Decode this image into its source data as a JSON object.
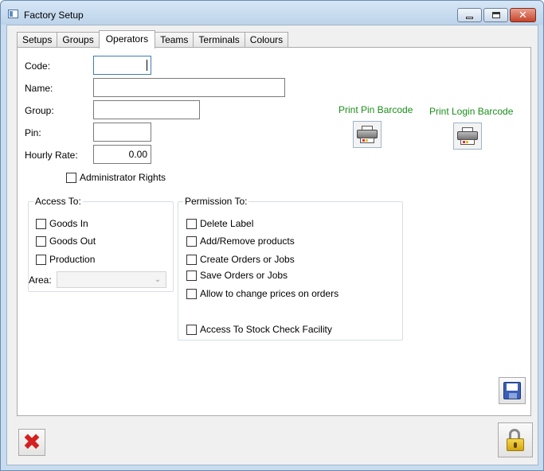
{
  "window": {
    "title": "Factory Setup"
  },
  "tabs": [
    {
      "label": "Setups",
      "active": false
    },
    {
      "label": "Groups",
      "active": false
    },
    {
      "label": "Operators",
      "active": true
    },
    {
      "label": "Teams",
      "active": false
    },
    {
      "label": "Terminals",
      "active": false
    },
    {
      "label": "Colours",
      "active": false
    }
  ],
  "form": {
    "code_label": "Code:",
    "code_value": "",
    "name_label": "Name:",
    "name_value": "",
    "group_label": "Group:",
    "group_value": "",
    "pin_label": "Pin:",
    "pin_value": "",
    "hourly_rate_label": "Hourly Rate:",
    "hourly_rate_value": "0.00",
    "admin_rights_label": "Administrator Rights",
    "admin_rights_checked": false
  },
  "access": {
    "title": "Access To:",
    "goods_in": "Goods In",
    "goods_out": "Goods Out",
    "production": "Production",
    "area_label": "Area:",
    "area_value": ""
  },
  "permission": {
    "title": "Permission To:",
    "delete_label": "Delete Label",
    "add_remove_products": "Add/Remove products",
    "create_orders": "Create Orders or Jobs",
    "save_orders": "Save Orders or Jobs",
    "change_prices": "Allow to change prices on orders",
    "stock_check": "Access To Stock Check Facility"
  },
  "print": {
    "pin_barcode": "Print Pin Barcode",
    "login_barcode": "Print Login Barcode"
  },
  "icons": {
    "printer": "printer-icon",
    "save": "floppy-disk-icon",
    "cancel": "red-x-icon",
    "lock": "padlock-icon"
  },
  "colors": {
    "title_bar": "#c9dcef",
    "print_label": "#1a8f1a",
    "close_button": "#c7432b",
    "save_icon": "#3b5fb5",
    "cancel_icon": "#d42020",
    "lock_icon": "#e8c02e"
  }
}
